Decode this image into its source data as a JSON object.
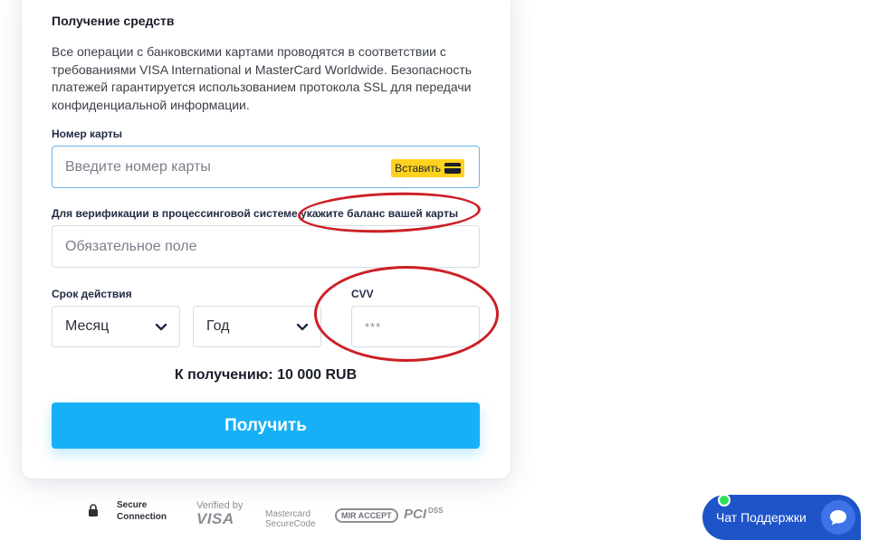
{
  "form": {
    "title": "Получение средств",
    "description": "Все операции с банковскими картами проводятся в соответствии с требованиями VISA International и MasterCard Worldwide. Безопасность платежей гарантируется использованием протокола SSL для передачи конфиденциальной информации.",
    "card_number": {
      "label": "Номер карты",
      "placeholder": "Введите номер карты",
      "value": "",
      "paste_label": "Вставить"
    },
    "balance": {
      "label": "Для верификации в процессинговой системе укажите баланс вашей карты",
      "placeholder": "Обязательное поле",
      "value": ""
    },
    "expiry": {
      "label": "Срок действия",
      "month_value": "Месяц",
      "year_value": "Год"
    },
    "cvv": {
      "label": "CVV",
      "placeholder": "***",
      "value": ""
    },
    "amount_text": "К получению: 10 000 RUB",
    "submit_label": "Получить"
  },
  "badges": {
    "secure_line1": "Secure",
    "secure_line2": "Connection",
    "verified_line1": "Verified by",
    "verified_line2": "VISA",
    "mastercard_line1": "Mastercard",
    "mastercard_line2": "SecureCode",
    "mir_label": "MIR ACCEPT",
    "pci_label": "PCI",
    "dss_label": "DSS"
  },
  "chat": {
    "label": "Чат Поддержки",
    "status_color": "#2ee05a"
  },
  "colors": {
    "accent": "#17b0f7",
    "paste": "#ffd21f",
    "annotation": "#cc1f26",
    "chat": "#1e54c8"
  }
}
